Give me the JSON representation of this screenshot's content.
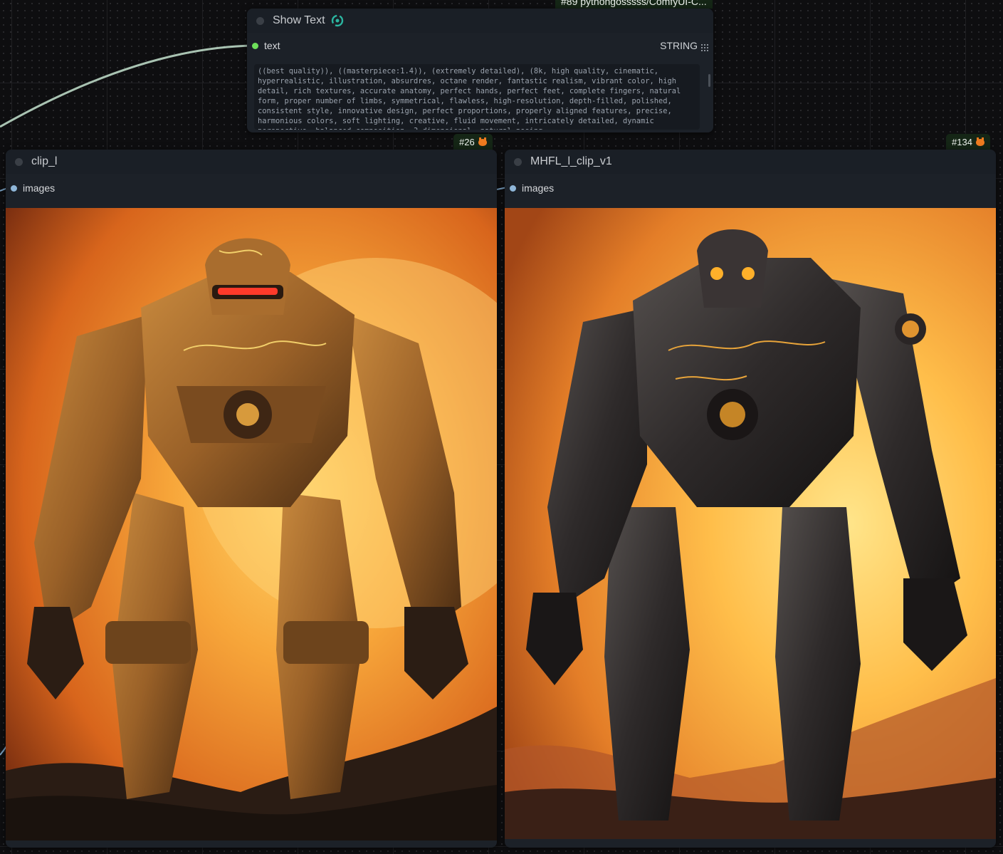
{
  "top_badge": {
    "label": "#89 pythongosssss/ComfyUI-C..."
  },
  "show_text": {
    "title": "Show Text",
    "title_icon": "refresh-cycle-icon",
    "slot_label": "text",
    "slot_type": "STRING",
    "text_value": "((best quality)), ((masterpiece:1.4)), (extremely detailed), (8k, high quality, cinematic, hyperrealistic, illustration, absurdres, octane render, fantastic realism, vibrant color, high detail, rich textures, accurate anatomy, perfect hands, perfect feet, complete fingers, natural form, proper number of limbs, symmetrical, flawless, high-resolution, depth-filled, polished, consistent style, innovative design, perfect proportions, properly aligned features, precise, harmonious colors, soft lighting, creative, fluid movement, intricately detailed, dynamic perspective, balanced composition, 3-dimensional, natural posing,"
  },
  "node_left": {
    "badge": "#26",
    "title": "clip_l",
    "slot_label": "images",
    "image_alt": "Bronze armored mech robot walking at sunset"
  },
  "node_right": {
    "badge": "#134",
    "title": "MHFL_l_clip_v1",
    "slot_label": "images",
    "image_alt": "Dark armored mech robot with glowing gold trim at sunset"
  },
  "colors": {
    "wire": "#a9c3b2",
    "string_slot": "#6ee05a",
    "image_slot": "#64b5f6",
    "badge_bg": "#152616"
  }
}
